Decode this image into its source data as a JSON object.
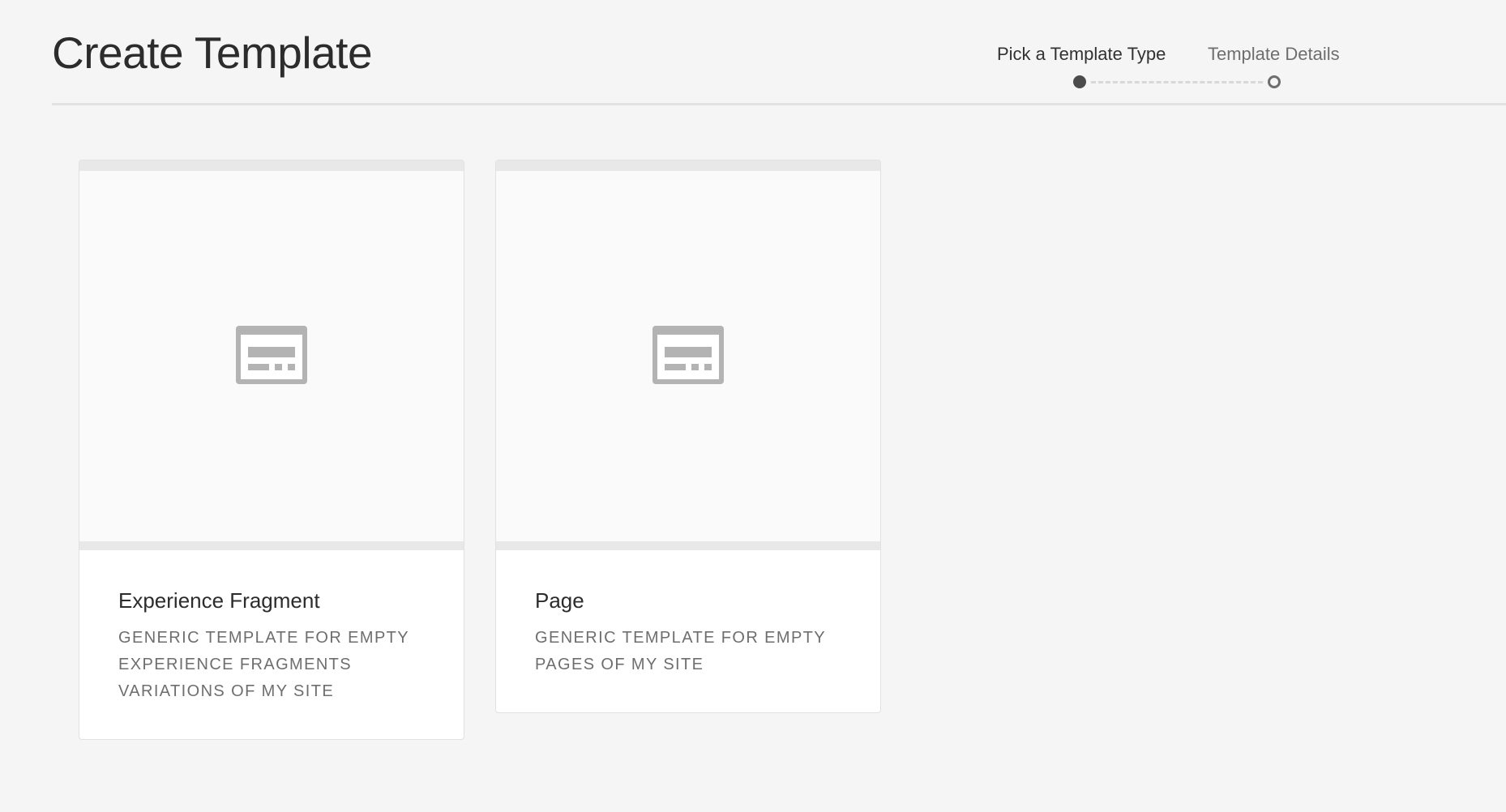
{
  "page": {
    "title": "Create Template"
  },
  "wizard": {
    "steps": [
      {
        "label": "Pick a Template Type",
        "state": "current"
      },
      {
        "label": "Template Details",
        "state": "upcoming"
      }
    ]
  },
  "cards": [
    {
      "title": "Experience Fragment",
      "description_lines": [
        "GENERIC TEMPLATE FOR EMPTY",
        "EXPERIENCE FRAGMENTS",
        "VARIATIONS OF MY SITE"
      ],
      "icon": "template-layout-icon"
    },
    {
      "title": "Page",
      "description_lines": [
        "GENERIC TEMPLATE FOR EMPTY",
        "PAGES OF MY SITE"
      ],
      "icon": "template-layout-icon"
    }
  ],
  "colors": {
    "background": "#f5f5f5",
    "card": "#ffffff",
    "icon": "#b3b3b3",
    "step_active": "#4b4b4b",
    "step_inactive": "#6e6e6e"
  }
}
